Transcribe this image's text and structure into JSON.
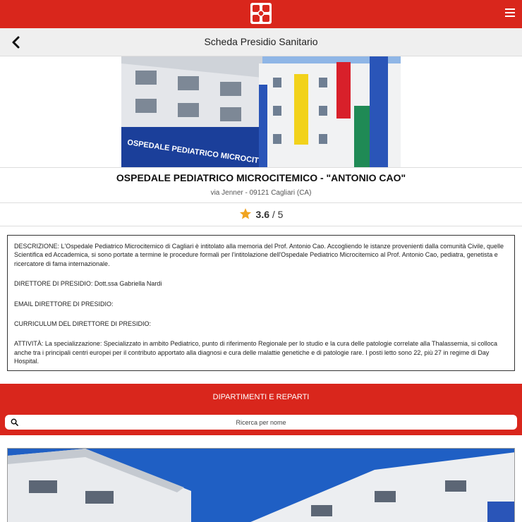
{
  "header": {
    "logo_icon": "hospital-cross-logo-icon",
    "menu_icon": "hamburger-menu-icon",
    "brand_color": "#d9261c"
  },
  "titlebar": {
    "back_icon": "chevron-left-icon",
    "title": "Scheda Presidio Sanitario"
  },
  "hospital": {
    "name": "OSPEDALE PEDIATRICO MICROCITEMICO - \"ANTONIO CAO\"",
    "address": "via Jenner - 09121 Cagliari (CA)",
    "rating": {
      "value": "3.6",
      "max": "5",
      "separator": " / ",
      "star_icon": "star-icon",
      "star_color": "#f0a420"
    }
  },
  "details": {
    "descrizione_label": "DESCRIZIONE:",
    "descrizione_text": " L'Ospedale Pediatrico Microcitemico di Cagliari è intitolato alla memoria del Prof. Antonio Cao. Accogliendo le istanze provenienti dalla comunità Civile, quelle Scientifica ed Accademica, si sono portate a termine le procedure formali per l'intitolazione dell'Ospedale Pediatrico Microcitemico al Prof. Antonio Cao, pediatra, genetista e ricercatore di fama internazionale.",
    "direttore_label": "DIRETTORE DI PRESIDIO:",
    "direttore_text": " Dott.ssa Gabriella Nardi",
    "email_label": "EMAIL DIRETTORE DI PRESIDIO:",
    "email_text": "",
    "curriculum_label": "CURRICULUM DEL DIRETTORE DI PRESIDIO:",
    "curriculum_text": "",
    "attivita_label": "ATTIVITÀ:",
    "attivita_text": " La specializzazione: Specializzato in ambito Pediatrico, punto di riferimento Regionale per lo studio e la cura delle patologie correlate alla Thalassemia, si colloca anche tra i principali centri europei per il contributo apportato alla diagnosi e cura delle malattie genetiche e di patologie rare. I posti letto sono 22, più 27 in regime di Day Hospital."
  },
  "departments": {
    "title": "DIPARTIMENTI E REPARTI",
    "search_icon": "search-icon",
    "search_placeholder": "Ricerca per nome",
    "search_value": ""
  },
  "images": {
    "hero_sign_text": "OSPEDALE PEDIATRICO MICROCITEMICO"
  }
}
